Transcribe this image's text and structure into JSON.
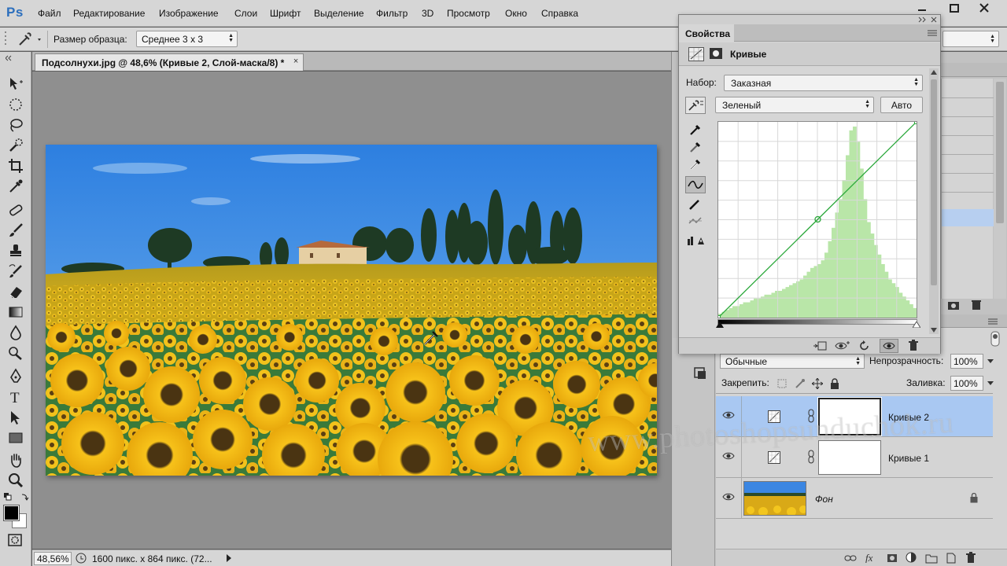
{
  "app": {
    "logo": "Ps"
  },
  "menu": [
    "Файл",
    "Редактирование",
    "Изображение",
    "Слои",
    "Шрифт",
    "Выделение",
    "Фильтр",
    "3D",
    "Просмотр",
    "Окно",
    "Справка"
  ],
  "options_bar": {
    "sample_label": "Размер образца:",
    "sample_value": "Среднее 3 x 3"
  },
  "document": {
    "tab_title": "Подсолнухи.jpg @ 48,6% (Кривые 2, Слой-маска/8) *",
    "tab_close": "×",
    "zoom": "48,56%",
    "status_text": "1600 пикс. x 864 пикс. (72..."
  },
  "properties": {
    "tab": "Свойства",
    "title": "Кривые",
    "preset_label": "Набор:",
    "preset_value": "Заказная",
    "channel_value": "Зеленый",
    "auto_label": "Авто",
    "curve": {
      "color": "#2aa83a",
      "histogram_color": "#b9e6a8",
      "points": [
        [
          0,
          0
        ],
        [
          128,
          128
        ],
        [
          255,
          255
        ]
      ],
      "histogram": [
        2,
        3,
        4,
        5,
        6,
        6,
        7,
        8,
        8,
        9,
        10,
        10,
        11,
        12,
        12,
        13,
        14,
        14,
        15,
        16,
        17,
        18,
        19,
        20,
        22,
        24,
        26,
        27,
        28,
        30,
        34,
        40,
        47,
        55,
        62,
        72,
        85,
        98,
        100,
        92,
        78,
        62,
        50,
        44,
        38,
        33,
        28,
        24,
        20,
        18,
        16,
        13,
        11,
        9,
        7,
        5
      ]
    }
  },
  "layers": {
    "blend_mode": "Обычные",
    "opacity_label": "Непрозрачность:",
    "opacity_value": "100%",
    "lock_label": "Закрепить:",
    "fill_label": "Заливка:",
    "fill_value": "100%",
    "items": [
      {
        "name": "Кривые 2",
        "selected": true
      },
      {
        "name": "Кривые 1",
        "selected": false
      },
      {
        "name": "Фон",
        "selected": false
      }
    ]
  },
  "watermark": "www.photoshopsunduchok.ru",
  "colors": {
    "accent": "#2c6fbd",
    "selected_layer": "#a9c8f2",
    "fg_color": "#000000",
    "bg_color": "#ffffff"
  }
}
